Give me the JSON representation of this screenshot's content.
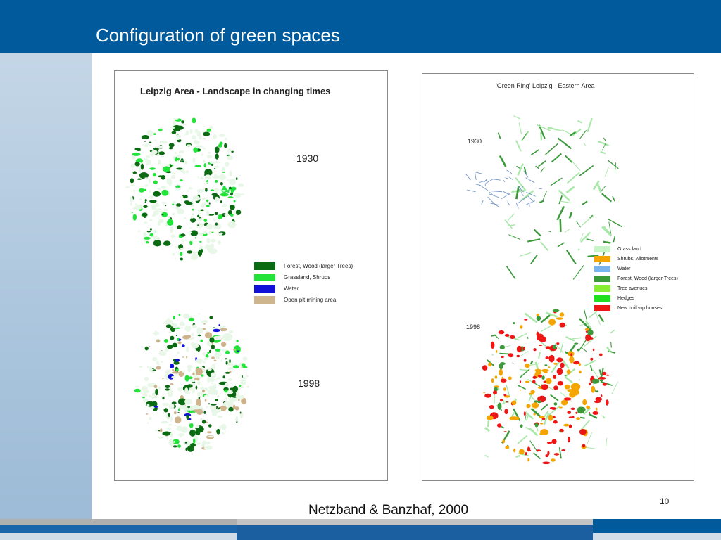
{
  "slide": {
    "title": "Configuration of green spaces",
    "source_caption": "Netzband & Banzhaf, 2000",
    "page_number": "10"
  },
  "left_figure": {
    "title": "Leipzig Area - Landscape in changing times",
    "year_top": "1930",
    "year_bottom": "1998",
    "legend": [
      {
        "label": "Forest, Wood (larger Trees)",
        "color": "#0b6b12"
      },
      {
        "label": "Grassland, Shrubs",
        "color": "#22e33a"
      },
      {
        "label": "Water",
        "color": "#1010d8"
      },
      {
        "label": "Open pit mining area",
        "color": "#cfb58e"
      }
    ]
  },
  "right_figure": {
    "title": "'Green Ring' Leipzig - Eastern Area",
    "year_top": "1930",
    "year_bottom": "1998",
    "legend": [
      {
        "label": "Grass land",
        "color": "#c8f5c8"
      },
      {
        "label": "Shrubs, Allotments",
        "color": "#f5a500"
      },
      {
        "label": "Water",
        "color": "#7ab4ec"
      },
      {
        "label": "Forest, Wood (larger Trees)",
        "color": "#3a9a3a"
      },
      {
        "label": "Tree avenues",
        "color": "#86ee34"
      },
      {
        "label": "Hedges",
        "color": "#1ee01e"
      },
      {
        "label": "New built-up houses",
        "color": "#ee1515"
      }
    ]
  },
  "colors": {
    "header": "#005a9c",
    "side_band": "#b4cde2"
  }
}
